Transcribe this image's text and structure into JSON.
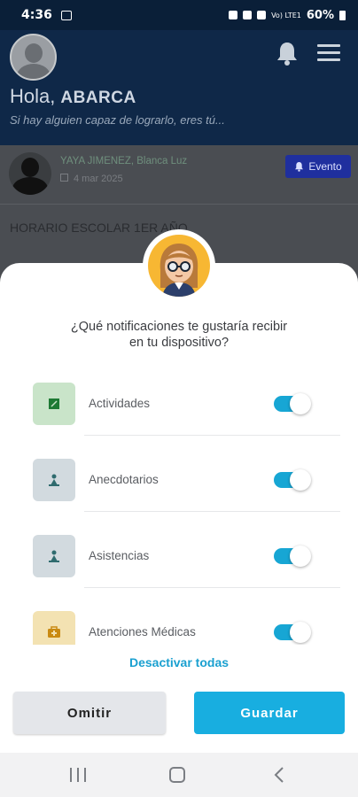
{
  "status_bar": {
    "time": "4:36",
    "battery": "60%",
    "signal": "Vo) LTE1"
  },
  "header": {
    "greeting": "Hola,",
    "user_name": "ABARCA",
    "tagline": "Si hay alguien capaz de lograrlo, eres tú..."
  },
  "post": {
    "author": "YAYA JIMENEZ, Blanca Luz",
    "date": "4 mar 2025",
    "badge": "Evento",
    "title": "HORARIO ESCOLAR 1ER AÑO"
  },
  "sheet": {
    "question_line1": "¿Qué notificaciones te gustaría recibir",
    "question_line2": "en tu dispositivo?",
    "items": [
      {
        "label": "Actividades",
        "enabled": true,
        "icon": "activities-icon",
        "bg": "#c9e4c9",
        "fg": "#1e7a34"
      },
      {
        "label": "Anecdotarios",
        "enabled": true,
        "icon": "anecdote-icon",
        "bg": "#d2dadf",
        "fg": "#2f6b6e"
      },
      {
        "label": "Asistencias",
        "enabled": true,
        "icon": "attendance-icon",
        "bg": "#d2dadf",
        "fg": "#2f6b6e"
      },
      {
        "label": "Atenciones Médicas",
        "enabled": true,
        "icon": "medical-kit-icon",
        "bg": "#f3e2b2",
        "fg": "#c98a12"
      }
    ],
    "deactivate_all": "Desactivar todas",
    "omit_label": "Omitir",
    "save_label": "Guardar"
  },
  "colors": {
    "accent": "#18aee0",
    "toggle_on": "#17a6d4",
    "header_bg": "#0f2848"
  }
}
